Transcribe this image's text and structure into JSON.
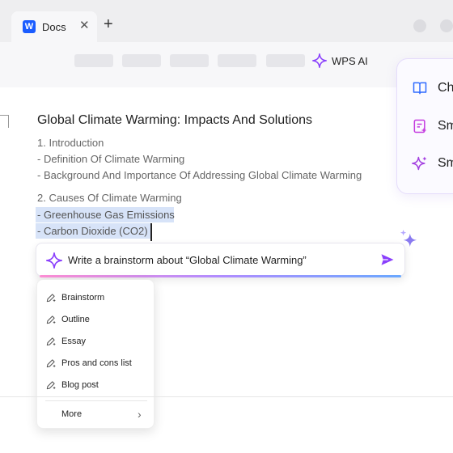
{
  "tabbar": {
    "tab_title": "Docs",
    "tab_logo_letter": "W",
    "close_glyph": "✕",
    "new_tab_glyph": "+"
  },
  "toolbar": {
    "ai_label": "WPS AI"
  },
  "right_panel": {
    "items": [
      {
        "label": "Ch",
        "icon": "book-icon"
      },
      {
        "label": "Sm",
        "icon": "doc-sparkle-icon"
      },
      {
        "label": "Sm",
        "icon": "sparkle-icon"
      }
    ]
  },
  "document": {
    "title": "Global Climate Warming: Impacts And Solutions",
    "lines": [
      "1. Introduction",
      "- Definition Of Climate Warming",
      "- Background And Importance Of Addressing Global Climate Warming",
      "2. Causes Of Climate Warming",
      "- Greenhouse Gas Emissions",
      "- Carbon Dioxide (CO2)"
    ]
  },
  "prompt": {
    "text": "Write a brainstorm about “Global Climate Warming”"
  },
  "menu": {
    "items": [
      "Brainstorm",
      "Outline",
      "Essay",
      "Pros and cons list",
      "Blog post"
    ],
    "more_label": "More",
    "more_chevron": "›"
  },
  "colors": {
    "accent_purple": "#8a3ffc",
    "highlight": "#d7e3f8",
    "brand_blue": "#1a5cff"
  }
}
